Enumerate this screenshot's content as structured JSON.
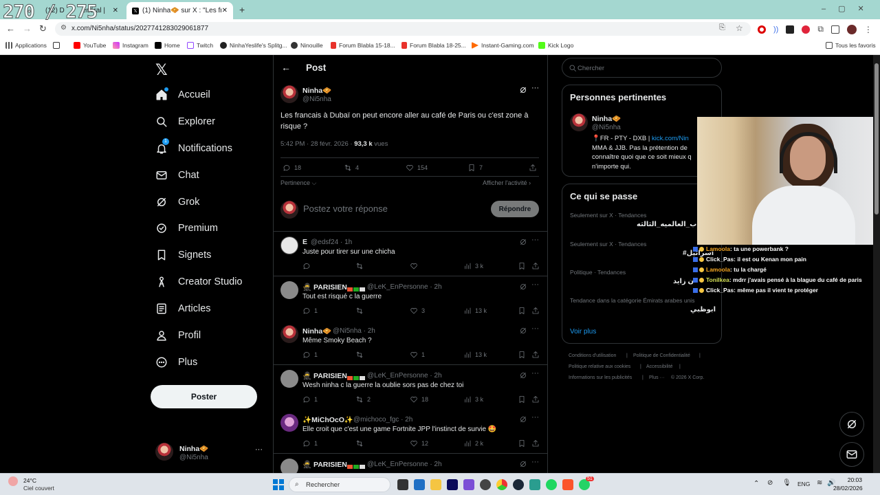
{
  "overlay_counter": "270 / 275",
  "browser": {
    "tabs": [
      {
        "label": "(12) D"
      },
      {
        "label": "énéral |"
      },
      {
        "label": "(1) Ninha🧇 sur X : \"Les francais"
      }
    ],
    "new_tab": "+",
    "url": "x.com/Ni5nha/status/2027741283029061877",
    "bookmarks": [
      "Applications",
      "YouTube",
      "Instagram",
      "Home",
      "Twitch",
      "NinhaYeslife's Splitg...",
      "Ninouille",
      "Forum Blabla 15-18...",
      "Forum Blabla 18-25...",
      "Instant-Gaming.com",
      "Kick Logo"
    ],
    "all_bookmarks": "Tous les favoris"
  },
  "nav": {
    "items": [
      "Accueil",
      "Explorer",
      "Notifications",
      "Chat",
      "Grok",
      "Premium",
      "Signets",
      "Creator Studio",
      "Articles",
      "Profil",
      "Plus"
    ],
    "notif_badge": "1",
    "post_button": "Poster",
    "account_name": "Ninha🧇",
    "account_handle": "@Ni5nha",
    "more": "···"
  },
  "header": {
    "title": "Post"
  },
  "post": {
    "name": "Ninha🧇",
    "handle": "@Ni5nha",
    "text": "Les francais à Dubaï on peut encore aller au café de Paris ou c'est zone à risque ?",
    "time": "5:42 PM · 28 févr. 2026 ·",
    "views": "93,3 k",
    "views_label": "vues",
    "replies": "18",
    "reposts": "4",
    "likes": "154",
    "bookmarks": "7",
    "relevance": "Pertinence",
    "show_activity": "Afficher l'activité",
    "reply_placeholder": "Postez votre réponse",
    "reply_button": "Répondre"
  },
  "replies": [
    {
      "name": "E",
      "handle": "@edsf24 · 1h",
      "text": "Juste pour tirer sur une chicha",
      "replies": "",
      "reposts": "",
      "likes": "",
      "views": "3 k"
    },
    {
      "name": "🥷 PARISIEN",
      "handle": "@LeK_EnPersonne · 2h",
      "text": "Tout est risqué c la guerre",
      "replies": "1",
      "reposts": "",
      "likes": "3",
      "views": "13 k"
    },
    {
      "name": "Ninha🧇",
      "handle": "@Ni5nha · 2h",
      "text": "Même Smoky Beach ?",
      "replies": "1",
      "reposts": "",
      "likes": "1",
      "views": "13 k"
    },
    {
      "name": "🥷 PARISIEN",
      "handle": "@LeK_EnPersonne · 2h",
      "text": "Wesh ninha c la guerre la oublie sors pas de chez toi",
      "replies": "1",
      "reposts": "2",
      "likes": "18",
      "views": "3 k"
    },
    {
      "name": "✨MiChOcO✨",
      "handle": "@michoco_fgc · 2h",
      "text": "Elle croit que c'est une game Fortnite JPP l'instinct de survie 🤩",
      "replies": "1",
      "reposts": "",
      "likes": "12",
      "views": "2 k"
    },
    {
      "name": "🥷 PARISIEN",
      "handle": "@LeK_EnPersonne · 2h",
      "text": "",
      "replies": "",
      "reposts": "",
      "likes": "",
      "views": ""
    }
  ],
  "right": {
    "search_placeholder": "Chercher",
    "relevant_title": "Personnes pertinentes",
    "relevant_name": "Ninha🧇",
    "relevant_handle": "@Ni5nha",
    "relevant_bio_1": "📍FR - PTY - DXB |",
    "relevant_bio_link": "kick.com/Nin",
    "relevant_bio_2": "MMA & JJB. Pas la prétention de",
    "relevant_bio_3": "connaître quoi que ce soit mieux q",
    "relevant_bio_4": "n'importe qui.",
    "happening_title": "Ce qui se passe",
    "trends": [
      {
        "context": "Seulement sur X · Tendances",
        "topic": "ب_العالميه_الثالثه"
      },
      {
        "context": "Seulement sur X · Tendances",
        "topic": "#اسرائيل"
      },
      {
        "context": "Politique · Tendances",
        "topic": "ن زايد"
      },
      {
        "context": "Tendance dans la catégorie Émirats arabes unis",
        "topic": "ابوظبي"
      }
    ],
    "see_more": "Voir plus",
    "footer": [
      "Conditions d'utilisation",
      "|",
      "Politique de Confidentialité",
      "|",
      "Politique relative aux cookies",
      "|",
      "Accessibilité",
      "|",
      "Informations sur les publicités",
      "|",
      "Plus ···",
      "© 2026 X Corp."
    ]
  },
  "chat": [
    {
      "user": "Lamoola",
      "msg": ": ta une powerbank ?",
      "color": "#f5a623"
    },
    {
      "user": "Click_Pas",
      "msg": ": il est ou Kenan mon pain",
      "color": "#ffffff"
    },
    {
      "user": "Lamoola",
      "msg": ": tu la chargé",
      "color": "#f5a623"
    },
    {
      "user": "Tonilkea",
      "msg": ": mdrr j'avais pensé à la blague du café de paris",
      "color": "#d4e157"
    },
    {
      "user": "Click_Pas",
      "msg": ": même pas il vient te protéger",
      "color": "#ffffff"
    }
  ],
  "taskbar": {
    "weather_temp": "24°C",
    "weather_desc": "Ciel couvert",
    "search": "Rechercher",
    "lang": "ENG",
    "time": "20:03",
    "date": "28/02/2026",
    "whatsapp_badge": "51"
  }
}
